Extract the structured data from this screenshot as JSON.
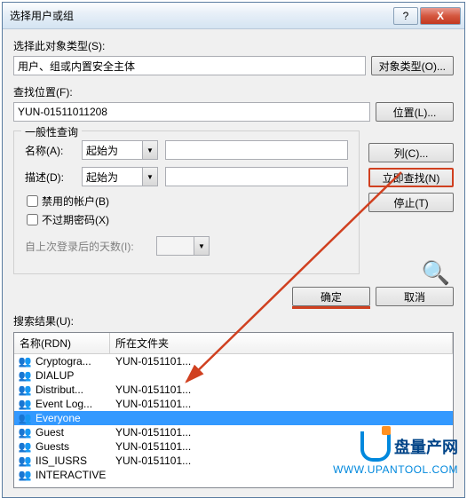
{
  "window": {
    "title": "选择用户或组",
    "help_symbol": "?",
    "close_symbol": "X"
  },
  "object_type": {
    "label": "选择此对象类型(S):",
    "value": "用户、组或内置安全主体",
    "button": "对象类型(O)..."
  },
  "location": {
    "label": "查找位置(F):",
    "value": "YUN-01511011208",
    "button": "位置(L)..."
  },
  "query": {
    "legend": "一般性查询",
    "name_label": "名称(A):",
    "name_combo": "起始为",
    "desc_label": "描述(D):",
    "desc_combo": "起始为",
    "chk_disabled": "禁用的帐户(B)",
    "chk_nopwd": "不过期密码(X)",
    "days_label": "自上次登录后的天数(I):"
  },
  "side_buttons": {
    "columns": "列(C)...",
    "find_now": "立即查找(N)",
    "stop": "停止(T)"
  },
  "actions": {
    "ok": "确定",
    "cancel": "取消"
  },
  "results": {
    "label": "搜索结果(U):",
    "col_name": "名称(RDN)",
    "col_folder": "所在文件夹",
    "rows": [
      {
        "name": "Cryptogra...",
        "folder": "YUN-0151101..."
      },
      {
        "name": "DIALUP",
        "folder": ""
      },
      {
        "name": "Distribut...",
        "folder": "YUN-0151101..."
      },
      {
        "name": "Event Log...",
        "folder": "YUN-0151101..."
      },
      {
        "name": "Everyone",
        "folder": ""
      },
      {
        "name": "Guest",
        "folder": "YUN-0151101..."
      },
      {
        "name": "Guests",
        "folder": "YUN-0151101..."
      },
      {
        "name": "IIS_IUSRS",
        "folder": "YUN-0151101..."
      },
      {
        "name": "INTERACTIVE",
        "folder": ""
      }
    ],
    "selected_index": 4
  },
  "watermark": {
    "text": "盘量产网",
    "url": "WWW.UPANTOOL.COM"
  }
}
